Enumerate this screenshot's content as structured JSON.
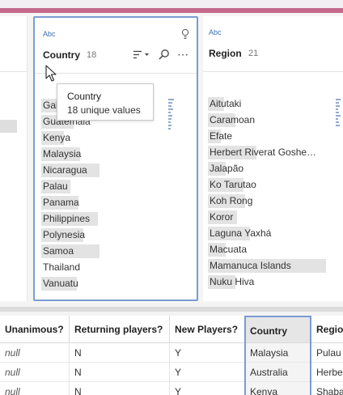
{
  "profile": {
    "country": {
      "type_label": "Abc",
      "name": "Country",
      "count": "18",
      "values": [
        "Gabon",
        "Guatemala",
        "Kenya",
        "Malaysia",
        "Nicaragua",
        "Palau",
        "Panama",
        "Philippines",
        "Polynesia",
        "Samoa",
        "Thailand",
        "Vanuatu"
      ],
      "tooltip_title": "Country",
      "tooltip_text": "18 unique values"
    },
    "region": {
      "type_label": "Abc",
      "name": "Region",
      "count": "21",
      "values": [
        "Aitutaki",
        "Caramoan",
        "Efate",
        "Herbert Riverat Goshe…",
        "Jalapão",
        "Ko Tarutao",
        "Koh Rong",
        "Koror",
        "Laguna Yaxhá",
        "Macuata",
        "Mamanuca Islands",
        "Nuku Hiva"
      ]
    }
  },
  "grid": {
    "headers": [
      "Unanimous?",
      "Returning players?",
      "New Players?",
      "Country",
      "Region"
    ],
    "rows": [
      [
        "null",
        "N",
        "Y",
        "Malaysia",
        "Pulau T"
      ],
      [
        "null",
        "N",
        "Y",
        "Australia",
        "Herber"
      ],
      [
        "null",
        "N",
        "Y",
        "Kenya",
        "Shaba"
      ]
    ]
  },
  "icons": [
    "bulb-icon",
    "sort-icon",
    "search-icon",
    "more-icon",
    "cursor-icon"
  ],
  "colors": {
    "accent_stripe": "#c46a8a",
    "selection": "#7a9cd3",
    "type_label": "#3a6fb0"
  }
}
